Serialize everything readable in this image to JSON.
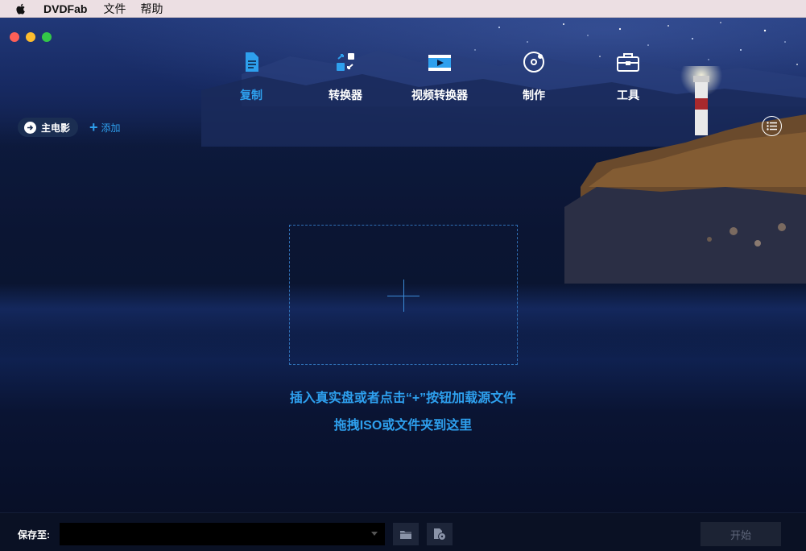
{
  "menubar": {
    "app_name": "DVDFab",
    "items": [
      "文件",
      "帮助"
    ]
  },
  "nav": {
    "items": [
      {
        "label": "复制",
        "icon": "copy-document-icon",
        "active": true
      },
      {
        "label": "转换器",
        "icon": "converter-icon",
        "active": false
      },
      {
        "label": "视频转换器",
        "icon": "video-converter-icon",
        "active": false
      },
      {
        "label": "制作",
        "icon": "disc-creator-icon",
        "active": false
      },
      {
        "label": "工具",
        "icon": "toolbox-icon",
        "active": false
      }
    ]
  },
  "subbar": {
    "movie_label": "主电影",
    "add_label": "添加"
  },
  "main": {
    "hint_line1": "插入真实盘或者点击“+”按钮加载源文件",
    "hint_line2": "拖拽ISO或文件夹到这里"
  },
  "bottom": {
    "save_label": "保存至:",
    "save_value": "",
    "start_label": "开始"
  },
  "colors": {
    "accent": "#2ea0ee",
    "background": "#0b1226"
  }
}
